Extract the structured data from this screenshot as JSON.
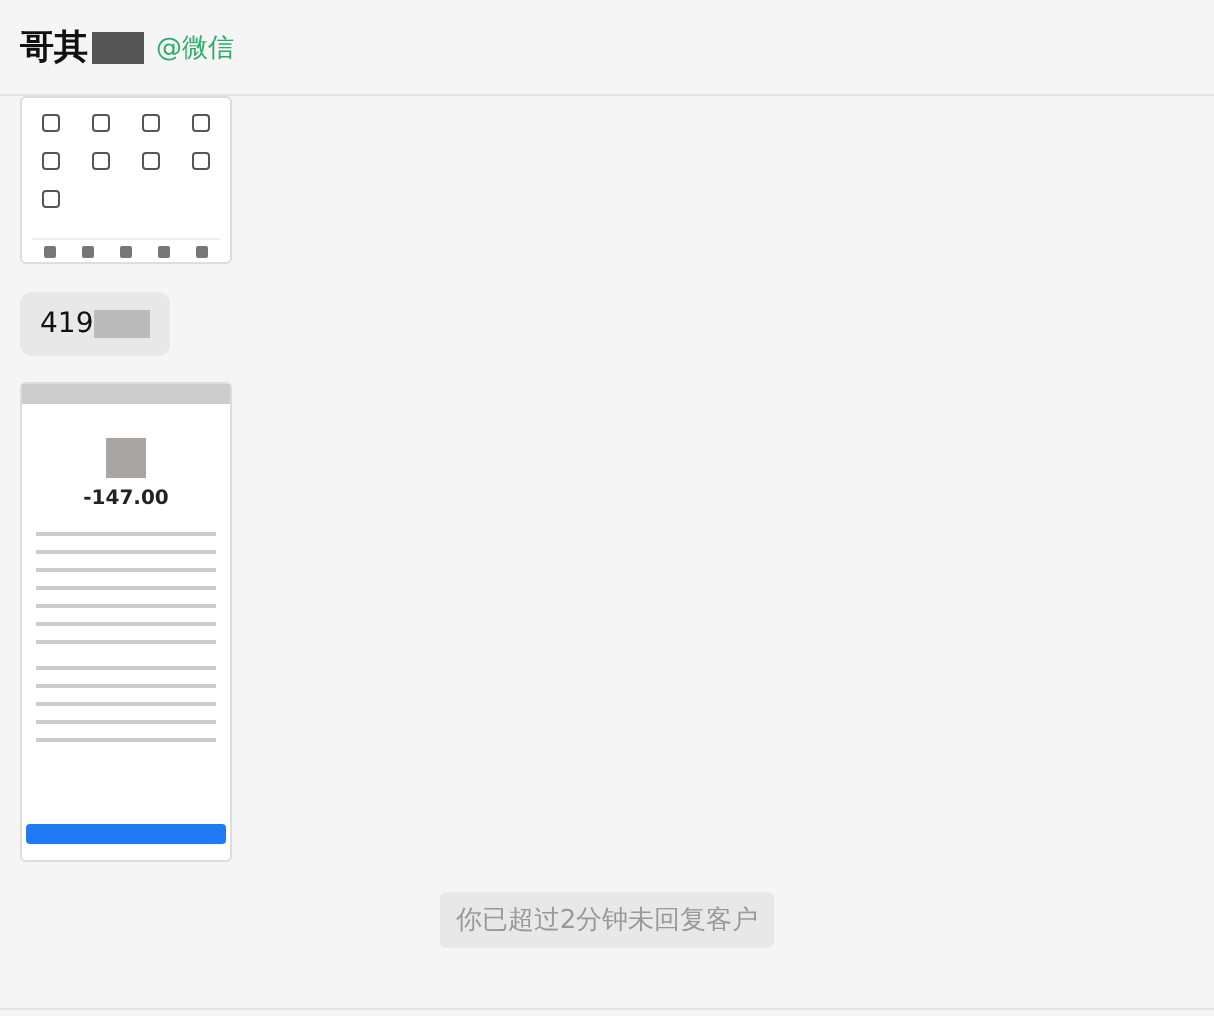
{
  "header": {
    "name": "哥其",
    "channel": "@微信"
  },
  "messages": [
    {
      "kind": "menushot"
    },
    {
      "kind": "text",
      "text": "419"
    },
    {
      "kind": "billshot",
      "amount": "-147.00"
    }
  ],
  "notice": "你已超过2分钟未回复客户"
}
